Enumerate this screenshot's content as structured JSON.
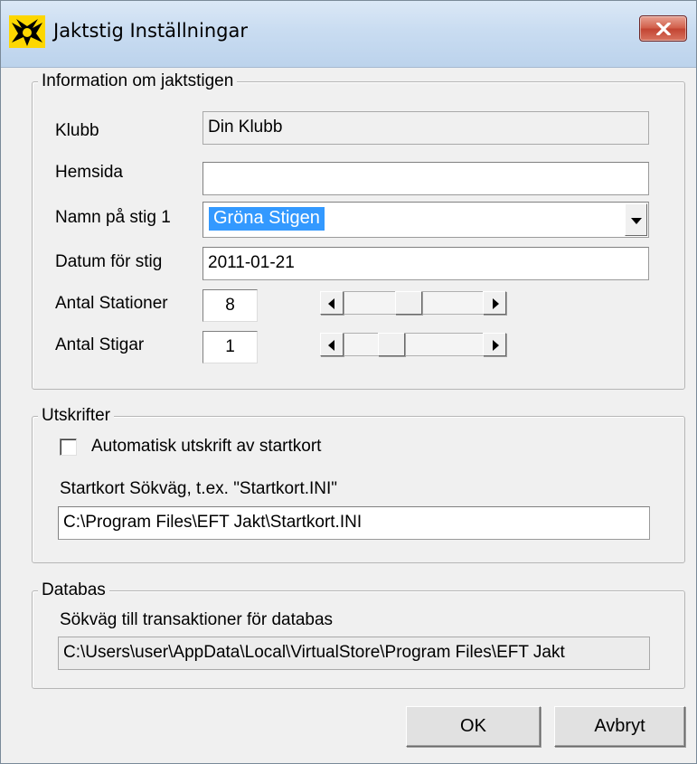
{
  "window": {
    "title": "Jaktstig Inställningar",
    "close_icon": "close-icon"
  },
  "info_group": {
    "legend": "Information om jaktstigen",
    "klubb_label": "Klubb",
    "klubb_value": "Din Klubb",
    "hemsida_label": "Hemsida",
    "hemsida_value": "",
    "namn_label": "Namn på stig 1",
    "namn_value": "Gröna Stigen",
    "datum_label": "Datum för stig",
    "datum_value": "2011-01-21",
    "stationer_label": "Antal Stationer",
    "stationer_value": "8",
    "stigar_label": "Antal Stigar",
    "stigar_value": "1"
  },
  "print_group": {
    "legend": "Utskrifter",
    "auto_print_label": "Automatisk utskrift av startkort",
    "auto_print_checked": false,
    "path_label": "Startkort Sökväg, t.ex. \"Startkort.INI\"",
    "path_value": "C:\\Program Files\\EFT Jakt\\Startkort.INI"
  },
  "db_group": {
    "legend": "Databas",
    "path_label": "Sökväg till transaktioner för databas",
    "path_value": "C:\\Users\\user\\AppData\\Local\\VirtualStore\\Program Files\\EFT Jakt"
  },
  "buttons": {
    "ok": "OK",
    "cancel": "Avbryt"
  },
  "colors": {
    "selection": "#3399ff",
    "close_button": "#c94a36"
  }
}
